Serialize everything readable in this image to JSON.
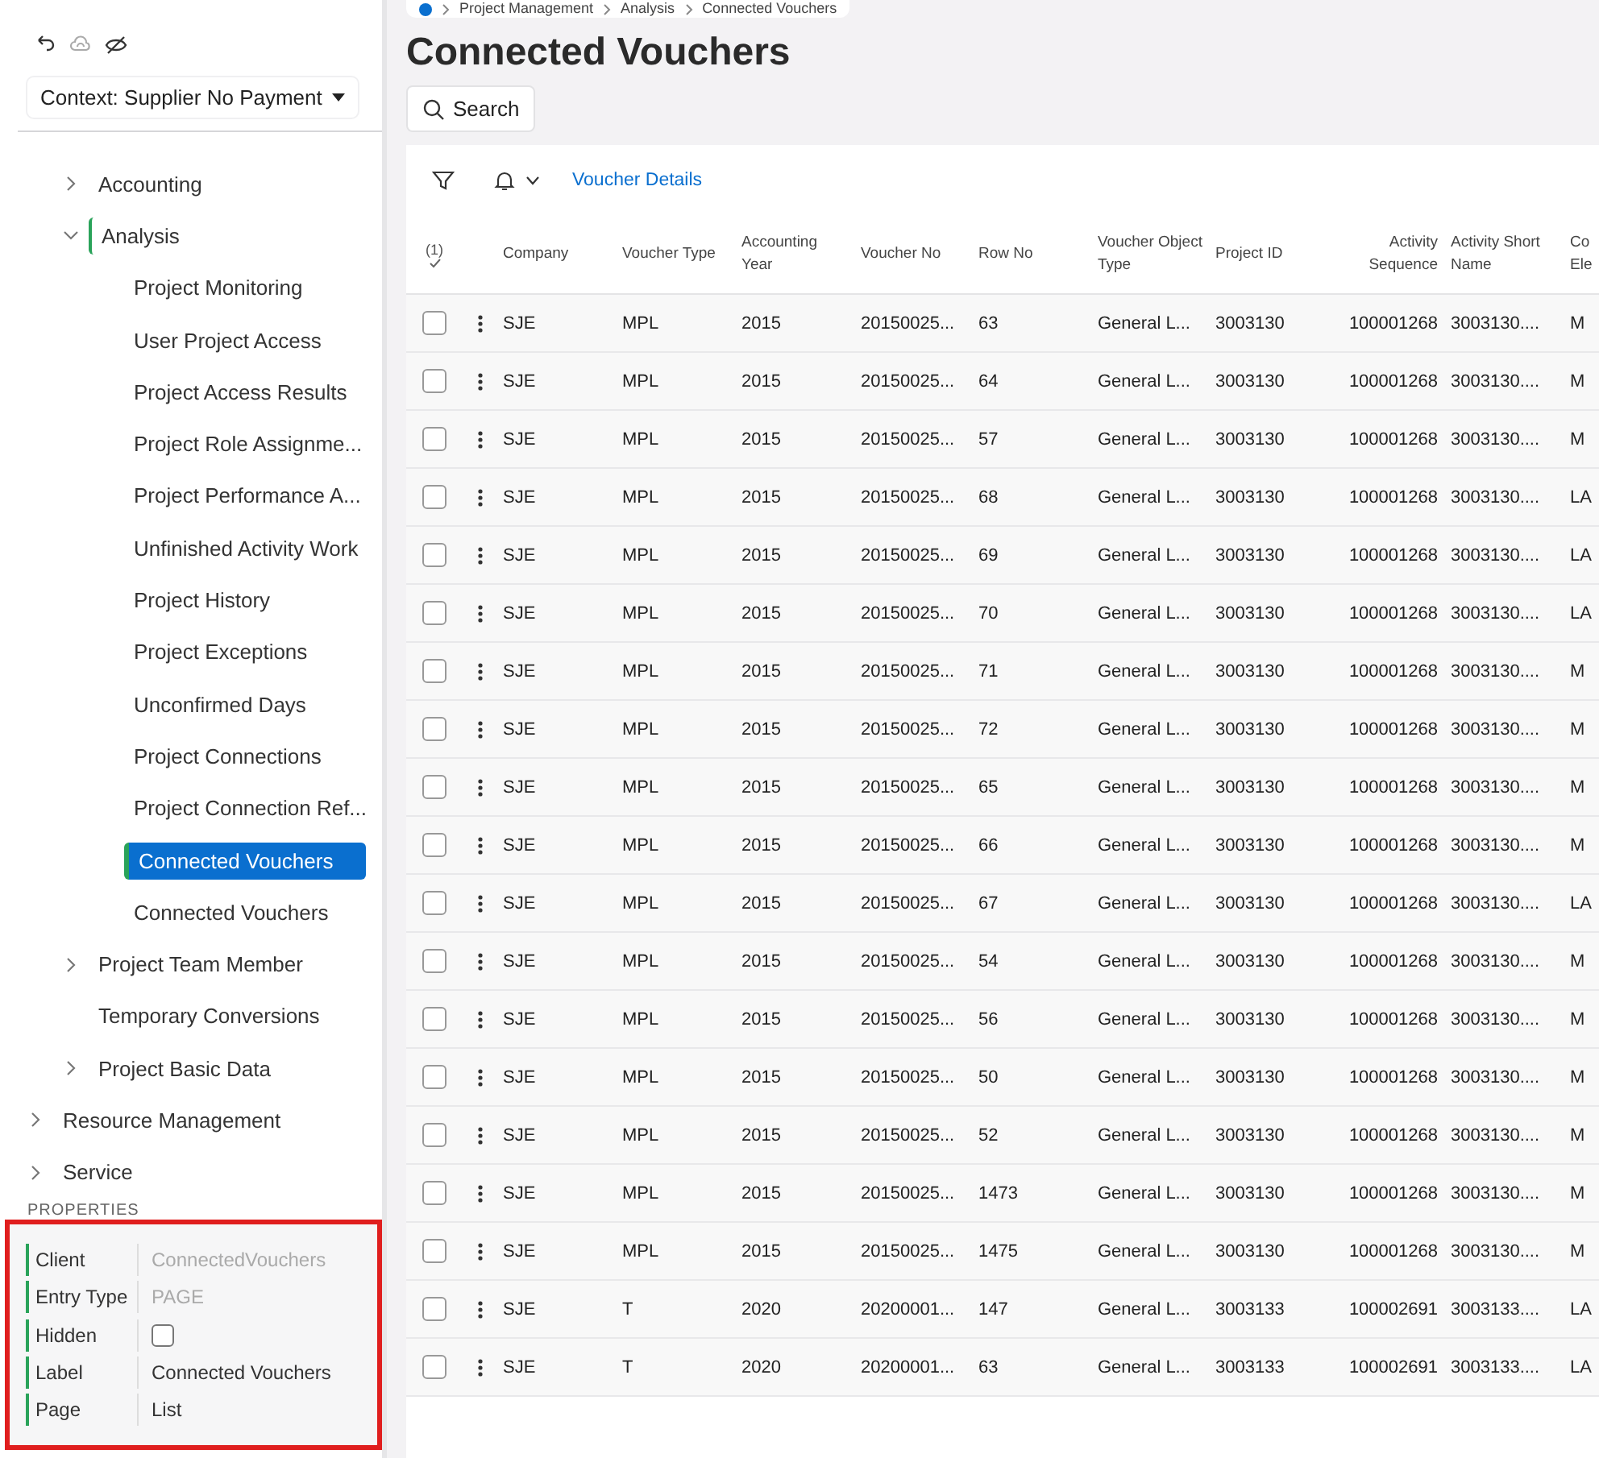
{
  "sidebar": {
    "context_button": "Context: Supplier No Payment",
    "tree": [
      {
        "children": [
          {
            "label": "Accounting",
            "expanded": false,
            "selected": false
          },
          {
            "label": "Analysis",
            "expanded": true,
            "selected": false,
            "children": [
              {
                "label": "Project Monitoring",
                "selected": false
              },
              {
                "label": "User Project Access",
                "selected": false
              },
              {
                "label": "Project Access Results",
                "selected": false
              },
              {
                "label": "Project Role Assignme...",
                "selected": false
              },
              {
                "label": "Project Performance A...",
                "selected": false
              },
              {
                "label": "Unfinished Activity Work",
                "selected": false
              },
              {
                "label": "Project History",
                "selected": false
              },
              {
                "label": "Project Exceptions",
                "selected": false
              },
              {
                "label": "Unconfirmed Days",
                "selected": false
              },
              {
                "label": "Project Connections",
                "selected": false
              },
              {
                "label": "Project Connection Ref...",
                "selected": false
              },
              {
                "label": "Connected Vouchers",
                "selected": true
              },
              {
                "label": "Connected Vouchers",
                "selected": false
              }
            ]
          },
          {
            "label": "Project Team Member",
            "expanded": false,
            "selected": false
          },
          {
            "label": "Temporary Conversions",
            "selected": false
          },
          {
            "label": "Project Basic Data",
            "expanded": false,
            "selected": false
          }
        ]
      },
      {
        "label": "Resource Management",
        "expanded": false,
        "selected": false
      },
      {
        "label": "Service",
        "expanded": false,
        "selected": false
      }
    ],
    "properties": {
      "title": "PROPERTIES",
      "rows": [
        {
          "label": "Client",
          "kind": "text",
          "value": "ConnectedVouchers",
          "disabled": true
        },
        {
          "label": "Entry Type",
          "kind": "text",
          "value": "PAGE",
          "disabled": true
        },
        {
          "label": "Hidden",
          "kind": "checkbox",
          "checked": false
        },
        {
          "label": "Label",
          "kind": "text",
          "value": "Connected Vouchers",
          "disabled": false
        },
        {
          "label": "Page",
          "kind": "text",
          "value": "List",
          "disabled": false
        }
      ]
    }
  },
  "breadcrumb": [
    "Project Management",
    "Analysis",
    "Connected Vouchers"
  ],
  "title": "Connected Vouchers",
  "search_button": "Search",
  "toolbar": {
    "link": "Voucher Details"
  },
  "table": {
    "selection_count": "(1)",
    "columns": [
      "Company",
      "Voucher Type",
      "Accounting Year",
      "Voucher No",
      "Row No",
      "Voucher Object Type",
      "Project ID",
      "Activity Sequence",
      "Activity Short Name",
      "Co Ele"
    ],
    "rows": [
      {
        "checked": false,
        "cells": [
          "SJE",
          "MPL",
          "2015",
          "20150025...",
          "63",
          "General L...",
          "3003130",
          "100001268",
          "3003130....",
          "M"
        ]
      },
      {
        "checked": false,
        "cells": [
          "SJE",
          "MPL",
          "2015",
          "20150025...",
          "64",
          "General L...",
          "3003130",
          "100001268",
          "3003130....",
          "M"
        ]
      },
      {
        "checked": false,
        "cells": [
          "SJE",
          "MPL",
          "2015",
          "20150025...",
          "57",
          "General L...",
          "3003130",
          "100001268",
          "3003130....",
          "M"
        ]
      },
      {
        "checked": false,
        "cells": [
          "SJE",
          "MPL",
          "2015",
          "20150025...",
          "68",
          "General L...",
          "3003130",
          "100001268",
          "3003130....",
          "LA"
        ]
      },
      {
        "checked": false,
        "cells": [
          "SJE",
          "MPL",
          "2015",
          "20150025...",
          "69",
          "General L...",
          "3003130",
          "100001268",
          "3003130....",
          "LA"
        ]
      },
      {
        "checked": false,
        "cells": [
          "SJE",
          "MPL",
          "2015",
          "20150025...",
          "70",
          "General L...",
          "3003130",
          "100001268",
          "3003130....",
          "LA"
        ]
      },
      {
        "checked": false,
        "cells": [
          "SJE",
          "MPL",
          "2015",
          "20150025...",
          "71",
          "General L...",
          "3003130",
          "100001268",
          "3003130....",
          "M"
        ]
      },
      {
        "checked": false,
        "cells": [
          "SJE",
          "MPL",
          "2015",
          "20150025...",
          "72",
          "General L...",
          "3003130",
          "100001268",
          "3003130....",
          "M"
        ]
      },
      {
        "checked": false,
        "cells": [
          "SJE",
          "MPL",
          "2015",
          "20150025...",
          "65",
          "General L...",
          "3003130",
          "100001268",
          "3003130....",
          "M"
        ]
      },
      {
        "checked": false,
        "cells": [
          "SJE",
          "MPL",
          "2015",
          "20150025...",
          "66",
          "General L...",
          "3003130",
          "100001268",
          "3003130....",
          "M"
        ]
      },
      {
        "checked": false,
        "cells": [
          "SJE",
          "MPL",
          "2015",
          "20150025...",
          "67",
          "General L...",
          "3003130",
          "100001268",
          "3003130....",
          "LA"
        ]
      },
      {
        "checked": false,
        "cells": [
          "SJE",
          "MPL",
          "2015",
          "20150025...",
          "54",
          "General L...",
          "3003130",
          "100001268",
          "3003130....",
          "M"
        ]
      },
      {
        "checked": false,
        "cells": [
          "SJE",
          "MPL",
          "2015",
          "20150025...",
          "56",
          "General L...",
          "3003130",
          "100001268",
          "3003130....",
          "M"
        ]
      },
      {
        "checked": false,
        "cells": [
          "SJE",
          "MPL",
          "2015",
          "20150025...",
          "50",
          "General L...",
          "3003130",
          "100001268",
          "3003130....",
          "M"
        ]
      },
      {
        "checked": false,
        "cells": [
          "SJE",
          "MPL",
          "2015",
          "20150025...",
          "52",
          "General L...",
          "3003130",
          "100001268",
          "3003130....",
          "M"
        ]
      },
      {
        "checked": false,
        "cells": [
          "SJE",
          "MPL",
          "2015",
          "20150025...",
          "1473",
          "General L...",
          "3003130",
          "100001268",
          "3003130....",
          "M"
        ]
      },
      {
        "checked": false,
        "cells": [
          "SJE",
          "MPL",
          "2015",
          "20150025...",
          "1475",
          "General L...",
          "3003130",
          "100001268",
          "3003130....",
          "M"
        ]
      },
      {
        "checked": false,
        "cells": [
          "SJE",
          "T",
          "2020",
          "20200001...",
          "147",
          "General L...",
          "3003133",
          "100002691",
          "3003133....",
          "LA"
        ]
      },
      {
        "checked": false,
        "cells": [
          "SJE",
          "T",
          "2020",
          "20200001...",
          "63",
          "General L...",
          "3003133",
          "100002691",
          "3003133....",
          "LA"
        ]
      }
    ]
  }
}
